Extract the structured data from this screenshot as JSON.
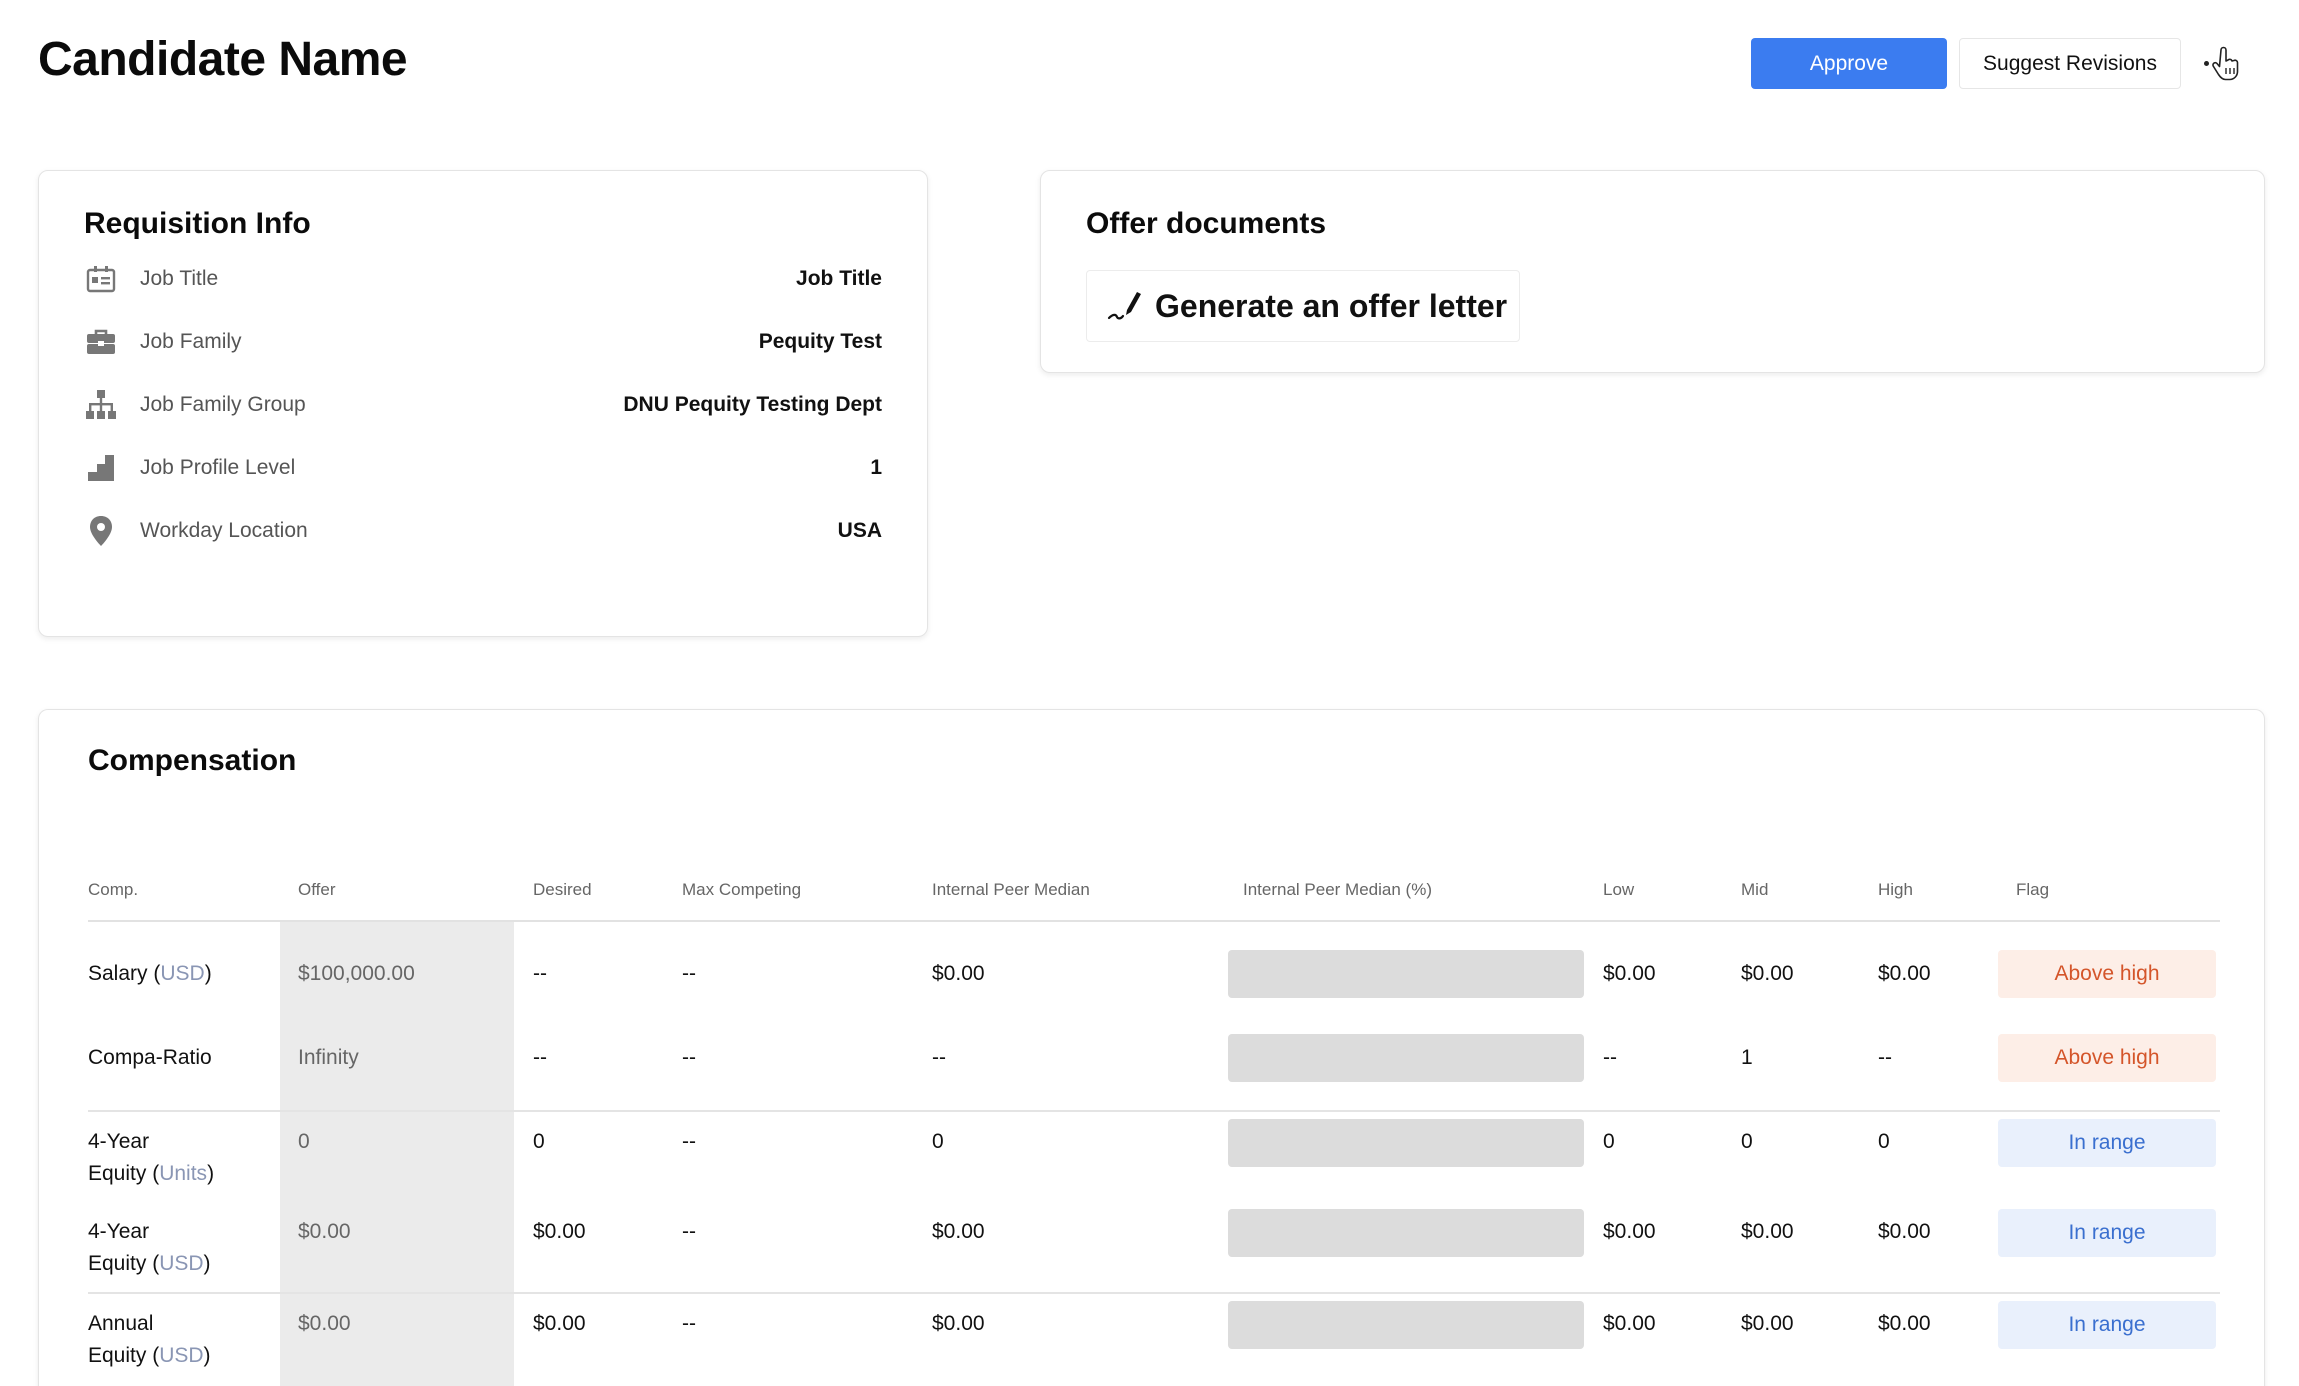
{
  "page": {
    "title": "Candidate Name"
  },
  "header": {
    "approve_label": "Approve",
    "suggest_label": "Suggest Revisions"
  },
  "colors": {
    "accent": "#3b7cf0",
    "flag_high_bg": "#fdeee7",
    "flag_high_text": "#d4552a",
    "flag_range_bg": "#e9f0fc",
    "flag_range_text": "#3a6fcf"
  },
  "requisition": {
    "title": "Requisition Info",
    "rows": [
      {
        "icon": "id-card-icon",
        "label": "Job Title",
        "value": "Job Title"
      },
      {
        "icon": "briefcase-icon",
        "label": "Job Family",
        "value": "Pequity Test"
      },
      {
        "icon": "org-chart-icon",
        "label": "Job Family Group",
        "value": "DNU Pequity Testing Dept"
      },
      {
        "icon": "level-steps-icon",
        "label": "Job Profile Level",
        "value": "1"
      },
      {
        "icon": "location-pin-icon",
        "label": "Workday Location",
        "value": "USA"
      }
    ]
  },
  "offer_docs": {
    "title": "Offer documents",
    "generate_label": "Generate an offer letter",
    "generate_icon": "pen-signature-icon"
  },
  "compensation": {
    "title": "Compensation",
    "columns": [
      "Comp.",
      "Offer",
      "Desired",
      "Max Competing",
      "Internal Peer Median",
      "Internal Peer Median (%)",
      "Low",
      "Mid",
      "High",
      "Flag"
    ],
    "rows": [
      {
        "name": "Salary (",
        "unit": "USD",
        "name_end": ")",
        "offer": "$100,000.00",
        "desired": "--",
        "max_competing": "--",
        "peer_median": "$0.00",
        "low": "$0.00",
        "mid": "$0.00",
        "high": "$0.00",
        "flag": "Above high",
        "flag_type": "high"
      },
      {
        "name": "Compa-Ratio",
        "unit": "",
        "name_end": "",
        "offer": "Infinity",
        "desired": "--",
        "max_competing": "--",
        "peer_median": "--",
        "low": "--",
        "mid": "1",
        "high": "--",
        "flag": "Above high",
        "flag_type": "high"
      },
      {
        "name1": "4-Year",
        "name2": "Equity (",
        "unit": "Units",
        "name_end": ")",
        "offer": "0",
        "desired": "0",
        "max_competing": "--",
        "peer_median": "0",
        "low": "0",
        "mid": "0",
        "high": "0",
        "flag": "In range",
        "flag_type": "range"
      },
      {
        "name1": "4-Year",
        "name2": "Equity (",
        "unit": "USD",
        "name_end": ")",
        "offer": "$0.00",
        "desired": "$0.00",
        "max_competing": "--",
        "peer_median": "$0.00",
        "low": "$0.00",
        "mid": "$0.00",
        "high": "$0.00",
        "flag": "In range",
        "flag_type": "range"
      },
      {
        "name1": "Annual",
        "name2": "Equity (",
        "unit": "USD",
        "name_end": ")",
        "offer": "$0.00",
        "desired": "$0.00",
        "max_competing": "--",
        "peer_median": "$0.00",
        "low": "$0.00",
        "mid": "$0.00",
        "high": "$0.00",
        "flag": "In range",
        "flag_type": "range"
      }
    ]
  }
}
